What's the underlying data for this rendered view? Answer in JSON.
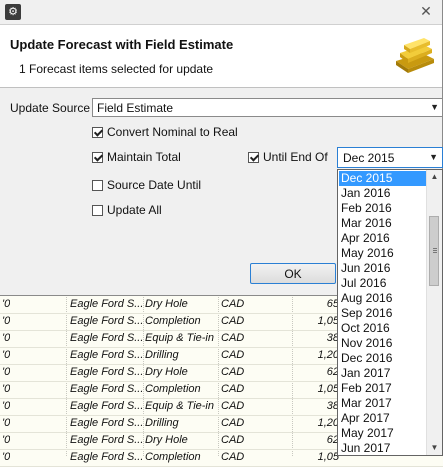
{
  "dialog": {
    "title": "Update Forecast with Field Estimate",
    "subtitle": "1 Forecast items selected for update",
    "update_source_label": "Update Source",
    "update_source_value": "Field Estimate",
    "convert_label": "Convert Nominal to Real",
    "convert_checked": true,
    "maintain_label": "Maintain Total",
    "maintain_checked": true,
    "until_end_label": "Until End Of",
    "until_end_checked": true,
    "until_end_value": "Dec 2015",
    "source_date_label": "Source Date Until",
    "source_date_checked": false,
    "update_all_label": "Update All",
    "update_all_checked": false,
    "ok_label": "OK"
  },
  "dropdown": {
    "selected_index": 0,
    "options": [
      "Dec 2015",
      "Jan 2016",
      "Feb 2016",
      "Mar 2016",
      "Apr 2016",
      "May 2016",
      "Jun 2016",
      "Jul 2016",
      "Aug 2016",
      "Sep 2016",
      "Oct 2016",
      "Nov 2016",
      "Dec 2016",
      "Jan 2017",
      "Feb 2017",
      "Mar 2017",
      "Apr 2017",
      "May 2017",
      "Jun 2017"
    ]
  },
  "grid": {
    "rows": [
      {
        "c0": "'0",
        "c1": "Eagle Ford S...",
        "c2": "Dry Hole",
        "c3": "CAD",
        "c4": "65"
      },
      {
        "c0": "'0",
        "c1": "Eagle Ford S...",
        "c2": "Completion",
        "c3": "CAD",
        "c4": "1,05"
      },
      {
        "c0": "'0",
        "c1": "Eagle Ford S...",
        "c2": "Equip & Tie-in",
        "c3": "CAD",
        "c4": "38"
      },
      {
        "c0": "'0",
        "c1": "Eagle Ford S...",
        "c2": "Drilling",
        "c3": "CAD",
        "c4": "1,20"
      },
      {
        "c0": "'0",
        "c1": "Eagle Ford S...",
        "c2": "Dry Hole",
        "c3": "CAD",
        "c4": "62"
      },
      {
        "c0": "'0",
        "c1": "Eagle Ford S...",
        "c2": "Completion",
        "c3": "CAD",
        "c4": "1,05"
      },
      {
        "c0": "'0",
        "c1": "Eagle Ford S...",
        "c2": "Equip & Tie-in",
        "c3": "CAD",
        "c4": "38"
      },
      {
        "c0": "'0",
        "c1": "Eagle Ford S...",
        "c2": "Drilling",
        "c3": "CAD",
        "c4": "1,20"
      },
      {
        "c0": "'0",
        "c1": "Eagle Ford S...",
        "c2": "Dry Hole",
        "c3": "CAD",
        "c4": "62"
      },
      {
        "c0": "'0",
        "c1": "Eagle Ford S...",
        "c2": "Completion",
        "c3": "CAD",
        "c4": "1,05"
      }
    ]
  },
  "colors": {
    "selection": "#3399ff",
    "focus_border": "#2a7fd4",
    "grid_background": "#fdfdf4"
  },
  "icons": {
    "app": "app-icon",
    "close": "close-icon",
    "header": "gold-bar-icon"
  }
}
